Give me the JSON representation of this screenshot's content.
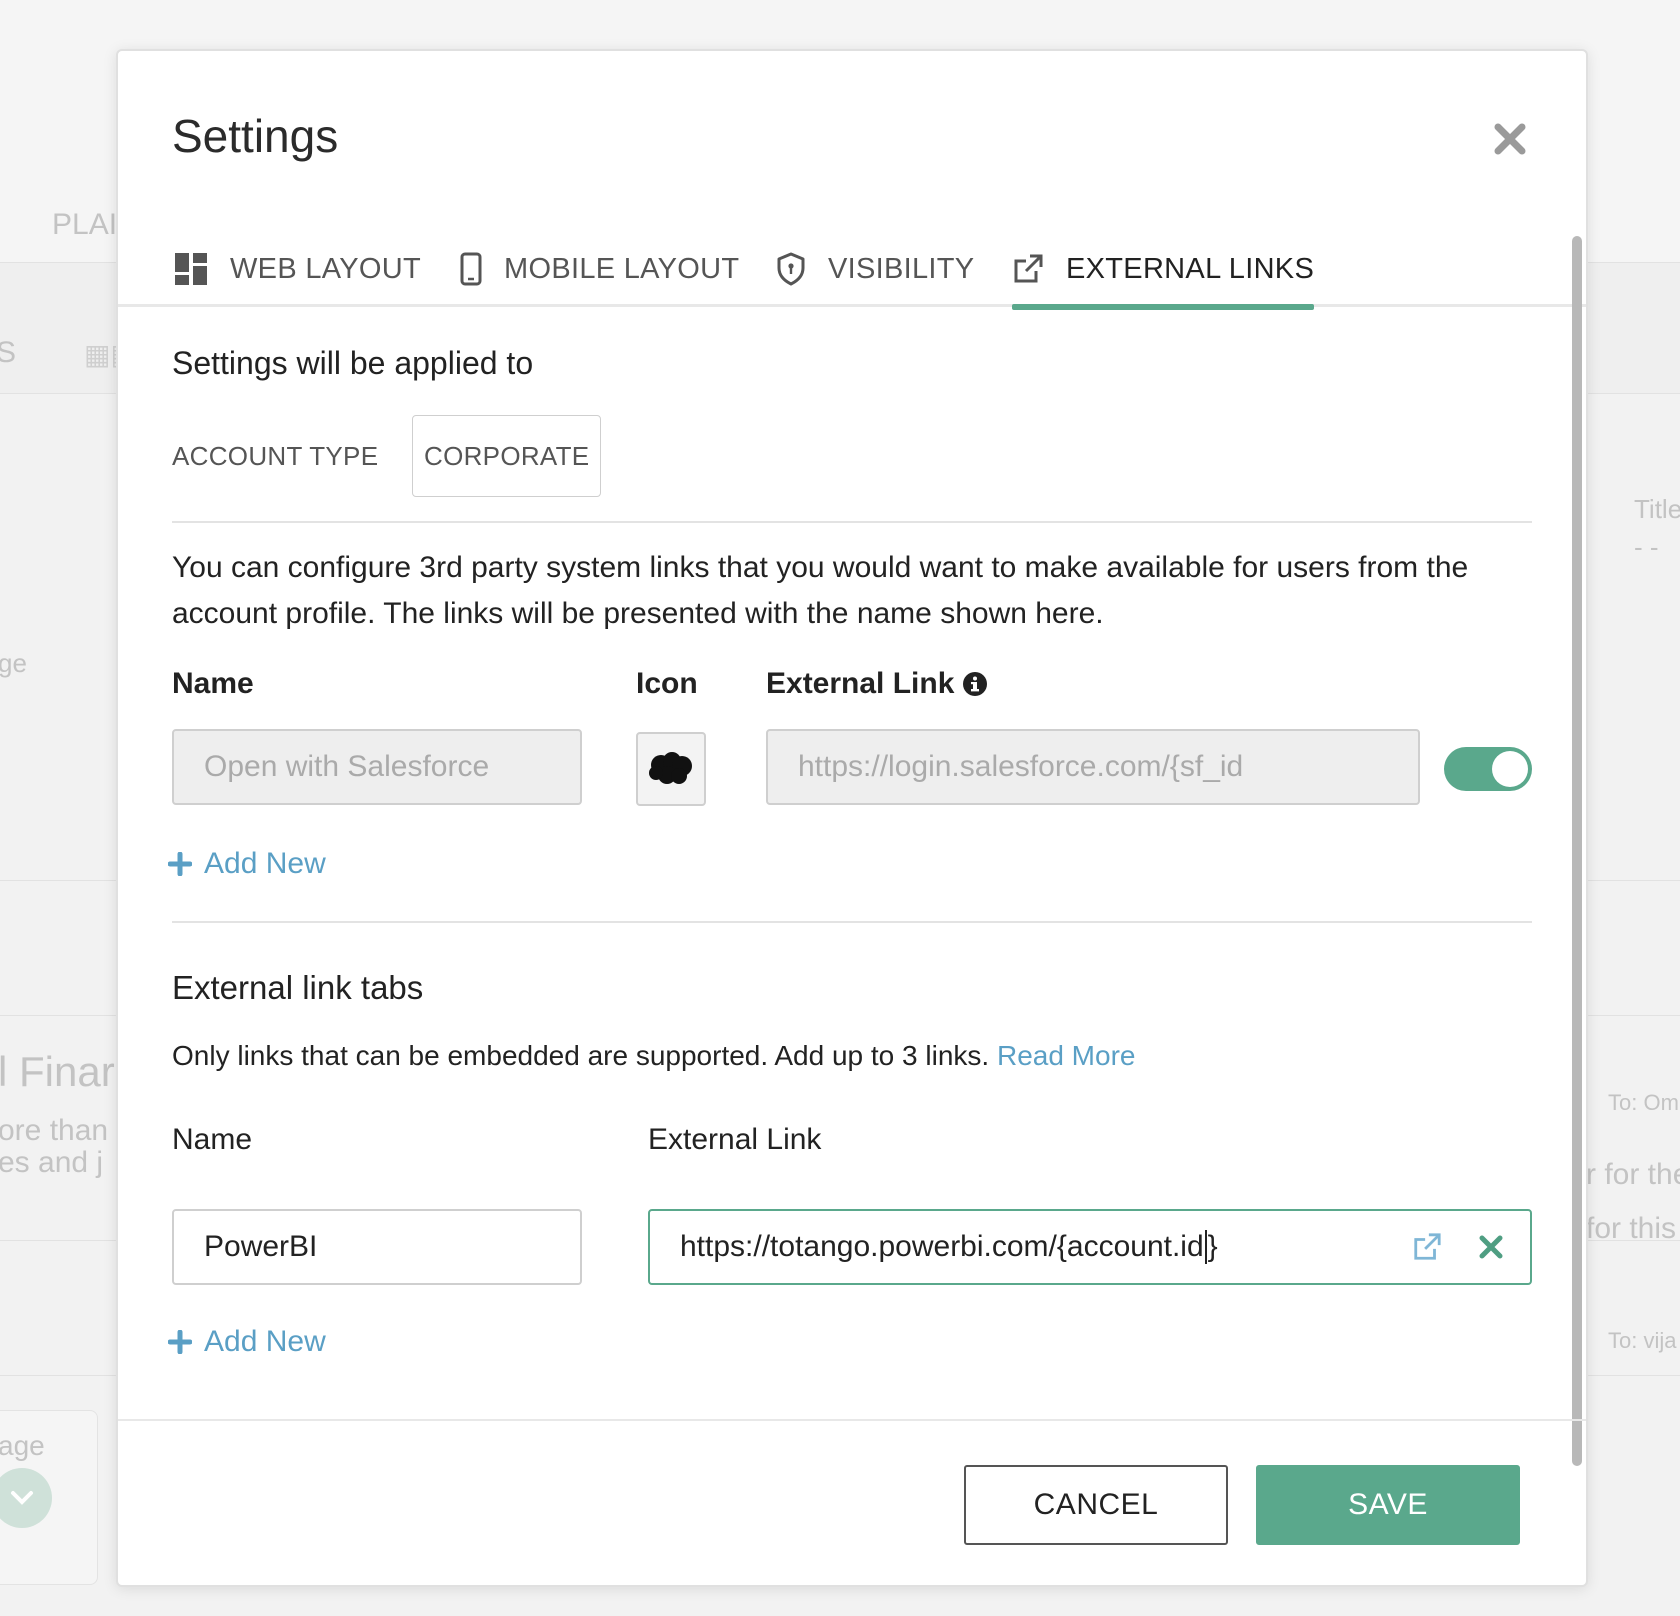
{
  "background": {
    "plan_tab_fragment": "PLAI",
    "s_fragment": "S",
    "ge_fragment": "ge",
    "finance_fragment": "l Finar",
    "ore_than_fragment": "ore than",
    "es_and_fragment": "es and j",
    "age_fragment": "age",
    "title_fragment": "Title",
    "dashes_fragment": "- -",
    "to_om_fragment": "To: Om",
    "for_the_fragment": "r for the",
    "for_this_fragment": "for this",
    "to_vija_fragment": "To: vija"
  },
  "modal": {
    "title": "Settings",
    "tabs": [
      {
        "label": "WEB LAYOUT",
        "icon": "grid-layout-icon",
        "active": false
      },
      {
        "label": "MOBILE LAYOUT",
        "icon": "mobile-icon",
        "active": false
      },
      {
        "label": "VISIBILITY",
        "icon": "shield-icon",
        "active": false
      },
      {
        "label": "EXTERNAL LINKS",
        "icon": "external-link-icon",
        "active": true
      }
    ],
    "applied": {
      "heading": "Settings will be applied to",
      "account_type_label": "ACCOUNT TYPE",
      "account_type_value": "CORPORATE"
    },
    "links": {
      "description": "You can configure 3rd party system links that you would want to make available for users from the account profile. The links will be presented with the name shown here.",
      "col_name": "Name",
      "col_icon": "Icon",
      "col_link": "External Link",
      "rows": [
        {
          "name_placeholder": "Open with Salesforce",
          "icon": "salesforce-cloud-icon",
          "link_placeholder": "https://login.salesforce.com/{sf_id",
          "enabled": true
        }
      ],
      "add_new": "Add New"
    },
    "tabs_section": {
      "heading": "External link tabs",
      "description": "Only links that can be embedded are supported. Add up to 3 links.",
      "read_more": "Read More",
      "col_name": "Name",
      "col_link": "External Link",
      "rows": [
        {
          "name": "PowerBI",
          "link_before_caret": "https://totango.powerbi.com/{account.id",
          "link_after_caret": "}"
        }
      ],
      "add_new": "Add New"
    },
    "buttons": {
      "cancel": "CANCEL",
      "save": "SAVE"
    },
    "colors": {
      "accent": "#5aa88c",
      "link": "#5a9fc5"
    }
  }
}
